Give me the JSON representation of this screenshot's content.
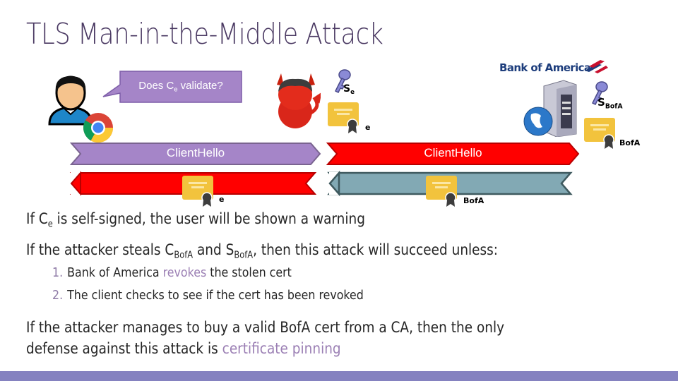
{
  "slide": {
    "title": "TLS Man-in-the-Middle Attack",
    "colors": {
      "title": "#4b3a63",
      "purple_arrow": "#a585c8",
      "red_arrow": "#ff0000",
      "teal_arrow": "#82a9b4",
      "highlight": "#9b7fb4",
      "bottom_bar": "#8582c0"
    }
  },
  "diagram": {
    "speech_bubble": {
      "prefix": "Does C",
      "sub": "e",
      "suffix": " validate?"
    },
    "attacker": {
      "key_label": "S",
      "key_sub": "e",
      "cert_label": "e"
    },
    "bank": {
      "logo_text": "Bank of America",
      "key_label": "S",
      "key_sub": "BofA",
      "cert_label": "BofA"
    },
    "arrows": [
      {
        "label": "ClientHello",
        "direction": "right",
        "color": "purple"
      },
      {
        "label": "ClientHello",
        "direction": "right",
        "color": "red"
      },
      {
        "label": "",
        "direction": "left",
        "color": "red",
        "cert_label": "e"
      },
      {
        "label": "",
        "direction": "left",
        "color": "teal",
        "cert_label": "BofA"
      }
    ],
    "icons": [
      "user-icon",
      "chrome-icon",
      "devil-attacker-icon",
      "key-icon",
      "certificate-icon",
      "server-globe-icon",
      "bofa-logo"
    ]
  },
  "text": {
    "line1": {
      "a": "If C",
      "sub": "e",
      "b": " is self-signed, the user will be shown a warning"
    },
    "line2": {
      "a": "If the attacker steals C",
      "sub1": "BofA",
      "b": " and S",
      "sub2": "BofA",
      "c": ", then this attack will succeed unless:"
    },
    "list": [
      {
        "num": "1.",
        "a": "Bank of America ",
        "hl": "revokes",
        "b": " the stolen cert"
      },
      {
        "num": "2.",
        "a": "The client checks to see if the cert has been revoked",
        "hl": "",
        "b": ""
      }
    ],
    "line3": {
      "a": "If the attacker manages to buy a valid BofA cert from a CA, then the only",
      "b": "defense against this attack is ",
      "hl": "certificate pinning"
    }
  }
}
